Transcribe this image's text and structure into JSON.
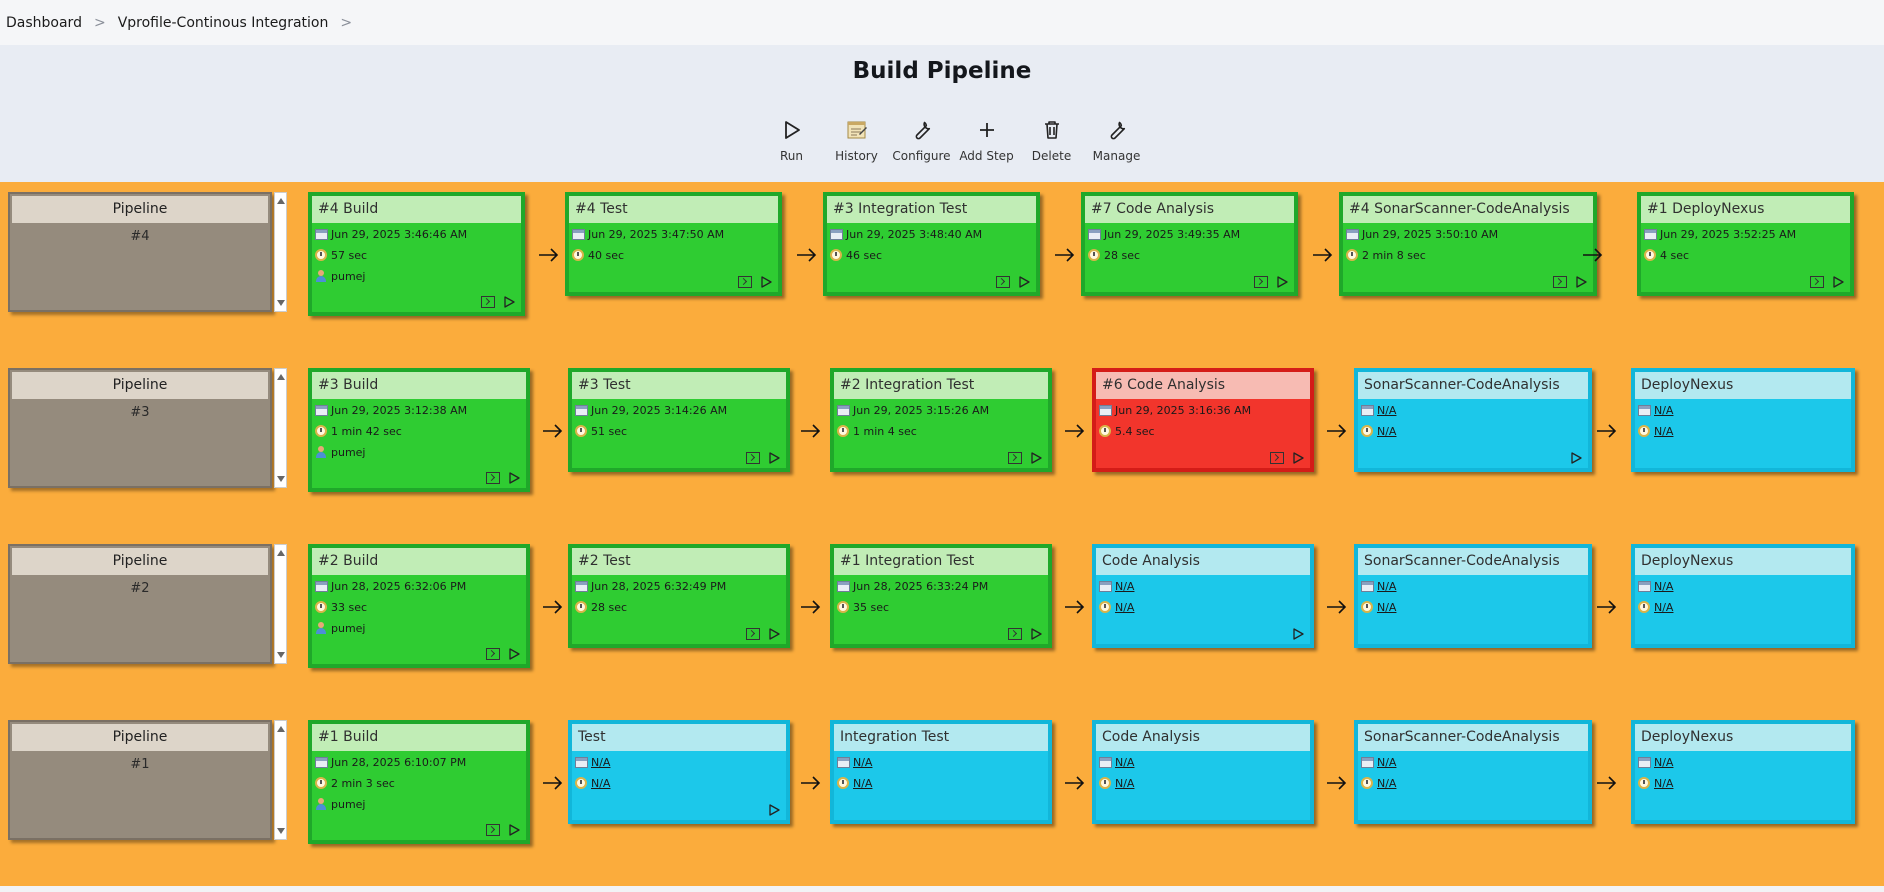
{
  "breadcrumb": {
    "items": [
      "Dashboard",
      "Vprofile-Continous Integration"
    ],
    "separator": ">"
  },
  "page": {
    "title": "Build Pipeline"
  },
  "toolbar": {
    "run": "Run",
    "history": "History",
    "configure": "Configure",
    "add_step": "Add Step",
    "delete": "Delete",
    "manage": "Manage"
  },
  "colors": {
    "success": "#2fcc32",
    "failed": "#f2352c",
    "pending": "#1cc8ea",
    "background": "#fbac3c",
    "pipeline_panel": "#958b7d"
  },
  "pipelines": [
    {
      "title": "Pipeline",
      "number": "#4",
      "stages": [
        {
          "title": "#4 Build",
          "status": "success",
          "date": "Jun 29, 2025 3:46:46 AM",
          "duration": "57 sec",
          "user": "pumej"
        },
        {
          "title": "#4 Test",
          "status": "success",
          "date": "Jun 29, 2025 3:47:50 AM",
          "duration": "40 sec"
        },
        {
          "title": "#3 Integration Test",
          "status": "success",
          "date": "Jun 29, 2025 3:48:40 AM",
          "duration": "46 sec"
        },
        {
          "title": "#7 Code Analysis",
          "status": "success",
          "date": "Jun 29, 2025 3:49:35 AM",
          "duration": "28 sec"
        },
        {
          "title": "#4 SonarScanner-CodeAnalysis",
          "status": "success",
          "date": "Jun 29, 2025 3:50:10 AM",
          "duration": "2 min 8 sec"
        },
        {
          "title": "#1 DeployNexus",
          "status": "success",
          "date": "Jun 29, 2025 3:52:25 AM",
          "duration": "4 sec"
        }
      ]
    },
    {
      "title": "Pipeline",
      "number": "#3",
      "stages": [
        {
          "title": "#3 Build",
          "status": "success",
          "date": "Jun 29, 2025 3:12:38 AM",
          "duration": "1 min 42 sec",
          "user": "pumej"
        },
        {
          "title": "#3 Test",
          "status": "success",
          "date": "Jun 29, 2025 3:14:26 AM",
          "duration": "51 sec"
        },
        {
          "title": "#2 Integration Test",
          "status": "success",
          "date": "Jun 29, 2025 3:15:26 AM",
          "duration": "1 min 4 sec"
        },
        {
          "title": "#6 Code Analysis",
          "status": "failed",
          "date": "Jun 29, 2025 3:16:36 AM",
          "duration": "5.4 sec"
        },
        {
          "title": "SonarScanner-CodeAnalysis",
          "status": "pending",
          "date": "N/A",
          "duration": "N/A"
        },
        {
          "title": "DeployNexus",
          "status": "pending",
          "date": "N/A",
          "duration": "N/A"
        }
      ]
    },
    {
      "title": "Pipeline",
      "number": "#2",
      "stages": [
        {
          "title": "#2 Build",
          "status": "success",
          "date": "Jun 28, 2025 6:32:06 PM",
          "duration": "33 sec",
          "user": "pumej"
        },
        {
          "title": "#2 Test",
          "status": "success",
          "date": "Jun 28, 2025 6:32:49 PM",
          "duration": "28 sec"
        },
        {
          "title": "#1 Integration Test",
          "status": "success",
          "date": "Jun 28, 2025 6:33:24 PM",
          "duration": "35 sec"
        },
        {
          "title": "Code Analysis",
          "status": "pending",
          "date": "N/A",
          "duration": "N/A"
        },
        {
          "title": "SonarScanner-CodeAnalysis",
          "status": "pending",
          "date": "N/A",
          "duration": "N/A"
        },
        {
          "title": "DeployNexus",
          "status": "pending",
          "date": "N/A",
          "duration": "N/A"
        }
      ]
    },
    {
      "title": "Pipeline",
      "number": "#1",
      "stages": [
        {
          "title": "#1 Build",
          "status": "success",
          "date": "Jun 28, 2025 6:10:07 PM",
          "duration": "2 min 3 sec",
          "user": "pumej"
        },
        {
          "title": "Test",
          "status": "pending",
          "date": "N/A",
          "duration": "N/A"
        },
        {
          "title": "Integration Test",
          "status": "pending",
          "date": "N/A",
          "duration": "N/A"
        },
        {
          "title": "Code Analysis",
          "status": "pending",
          "date": "N/A",
          "duration": "N/A"
        },
        {
          "title": "SonarScanner-CodeAnalysis",
          "status": "pending",
          "date": "N/A",
          "duration": "N/A"
        },
        {
          "title": "DeployNexus",
          "status": "pending",
          "date": "N/A",
          "duration": "N/A"
        }
      ]
    }
  ]
}
